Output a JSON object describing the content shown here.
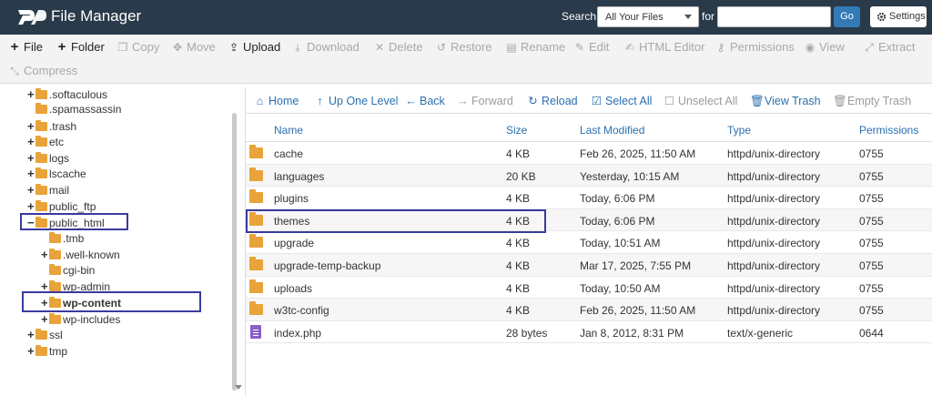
{
  "header": {
    "title": "File Manager",
    "search_label": "Search",
    "search_scope": "All Your Files",
    "for_label": "for",
    "search_value": "",
    "go_label": "Go",
    "settings_label": "Settings"
  },
  "toolbar": {
    "file": "File",
    "folder": "Folder",
    "copy": "Copy",
    "move": "Move",
    "upload": "Upload",
    "download": "Download",
    "delete": "Delete",
    "restore": "Restore",
    "rename": "Rename",
    "edit": "Edit",
    "html_editor": "HTML Editor",
    "permissions": "Permissions",
    "view": "View",
    "extract": "Extract",
    "compress": "Compress"
  },
  "tree": [
    {
      "name": ".softaculous",
      "expander": "+"
    },
    {
      "name": ".spamassassin",
      "expander": ""
    },
    {
      "name": ".trash",
      "expander": "+"
    },
    {
      "name": "etc",
      "expander": "+"
    },
    {
      "name": "logs",
      "expander": "+"
    },
    {
      "name": "lscache",
      "expander": "+"
    },
    {
      "name": "mail",
      "expander": "+"
    },
    {
      "name": "public_ftp",
      "expander": "+"
    },
    {
      "name": "public_html",
      "expander": "−"
    },
    {
      "name": ".tmb",
      "expander": ""
    },
    {
      "name": ".well-known",
      "expander": "+"
    },
    {
      "name": "cgi-bin",
      "expander": ""
    },
    {
      "name": "wp-admin",
      "expander": "+"
    },
    {
      "name": "wp-content",
      "expander": "+"
    },
    {
      "name": "wp-includes",
      "expander": "+"
    },
    {
      "name": "ssl",
      "expander": "+"
    },
    {
      "name": "tmp",
      "expander": "+"
    }
  ],
  "nav": {
    "home": "Home",
    "up": "Up One Level",
    "back": "Back",
    "forward": "Forward",
    "reload": "Reload",
    "select_all": "Select All",
    "unselect_all": "Unselect All",
    "view_trash": "View Trash",
    "empty_trash": "Empty Trash"
  },
  "table": {
    "columns": [
      "Name",
      "Size",
      "Last Modified",
      "Type",
      "Permissions"
    ],
    "rows": [
      {
        "name": "cache",
        "size": "4 KB",
        "modified": "Feb 26, 2025, 11:50 AM",
        "type": "httpd/unix-directory",
        "perms": "0755",
        "icon": "folder-icon"
      },
      {
        "name": "languages",
        "size": "20 KB",
        "modified": "Yesterday, 10:15 AM",
        "type": "httpd/unix-directory",
        "perms": "0755",
        "icon": "folder-icon"
      },
      {
        "name": "plugins",
        "size": "4 KB",
        "modified": "Today, 6:06 PM",
        "type": "httpd/unix-directory",
        "perms": "0755",
        "icon": "folder-icon"
      },
      {
        "name": "themes",
        "size": "4 KB",
        "modified": "Today, 6:06 PM",
        "type": "httpd/unix-directory",
        "perms": "0755",
        "icon": "folder-icon"
      },
      {
        "name": "upgrade",
        "size": "4 KB",
        "modified": "Today, 10:51 AM",
        "type": "httpd/unix-directory",
        "perms": "0755",
        "icon": "folder-icon"
      },
      {
        "name": "upgrade-temp-backup",
        "size": "4 KB",
        "modified": "Mar 17, 2025, 7:55 PM",
        "type": "httpd/unix-directory",
        "perms": "0755",
        "icon": "folder-icon"
      },
      {
        "name": "uploads",
        "size": "4 KB",
        "modified": "Today, 10:50 AM",
        "type": "httpd/unix-directory",
        "perms": "0755",
        "icon": "folder-icon"
      },
      {
        "name": "w3tc-config",
        "size": "4 KB",
        "modified": "Feb 26, 2025, 11:50 AM",
        "type": "httpd/unix-directory",
        "perms": "0755",
        "icon": "folder-icon"
      },
      {
        "name": "index.php",
        "size": "28 bytes",
        "modified": "Jan 8, 2012, 8:31 PM",
        "type": "text/x-generic",
        "perms": "0644",
        "icon": "file-icon"
      }
    ]
  },
  "colors": {
    "header_bg": "#293a4a",
    "link_blue": "#2a6fb0",
    "folder": "#e8a33a",
    "highlight": "#3a3aa0",
    "go_button": "#337ab7"
  }
}
